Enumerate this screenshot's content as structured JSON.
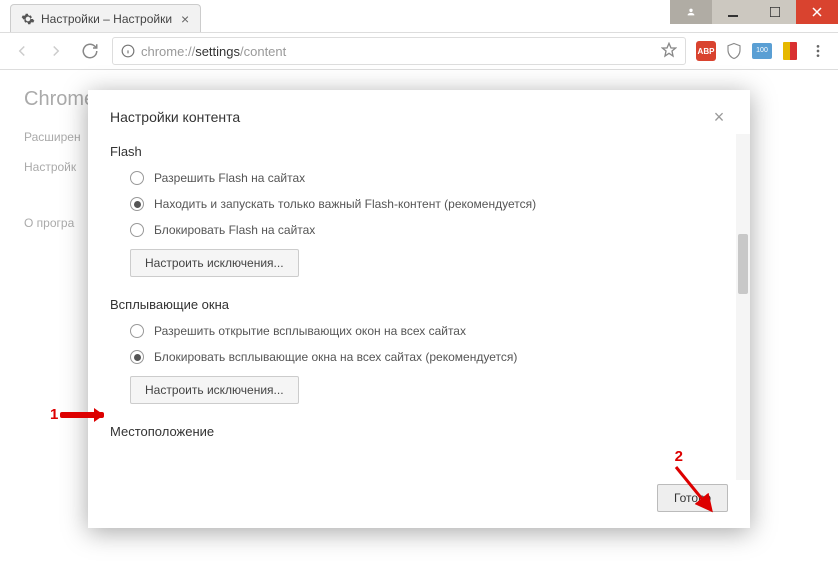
{
  "tab": {
    "title": "Настройки – Настройки"
  },
  "omnibox": {
    "prefix": "chrome://",
    "path": "settings",
    "suffix": "/content"
  },
  "page": {
    "title": "Chrome"
  },
  "sidebar": {
    "items": [
      "Расширен",
      "Настройк",
      "О програ"
    ]
  },
  "modal": {
    "title": "Настройки контента",
    "close_aria": "Закрыть",
    "sections": [
      {
        "title": "Flash",
        "options": [
          {
            "label": "Разрешить Flash на сайтах",
            "checked": false
          },
          {
            "label": "Находить и запускать только важный Flash-контент (рекомендуется)",
            "checked": true
          },
          {
            "label": "Блокировать Flash на сайтах",
            "checked": false
          }
        ],
        "config_label": "Настроить исключения..."
      },
      {
        "title": "Всплывающие окна",
        "options": [
          {
            "label": "Разрешить открытие всплывающих окон на всех сайтах",
            "checked": false
          },
          {
            "label": "Блокировать всплывающие окна на всех сайтах (рекомендуется)",
            "checked": true
          }
        ],
        "config_label": "Настроить исключения..."
      },
      {
        "title": "Местоположение",
        "options": [],
        "config_label": ""
      }
    ],
    "done_label": "Готово"
  },
  "annotations": {
    "one": "1",
    "two": "2"
  },
  "ext": {
    "abp": "ABP",
    "idm": "100"
  }
}
